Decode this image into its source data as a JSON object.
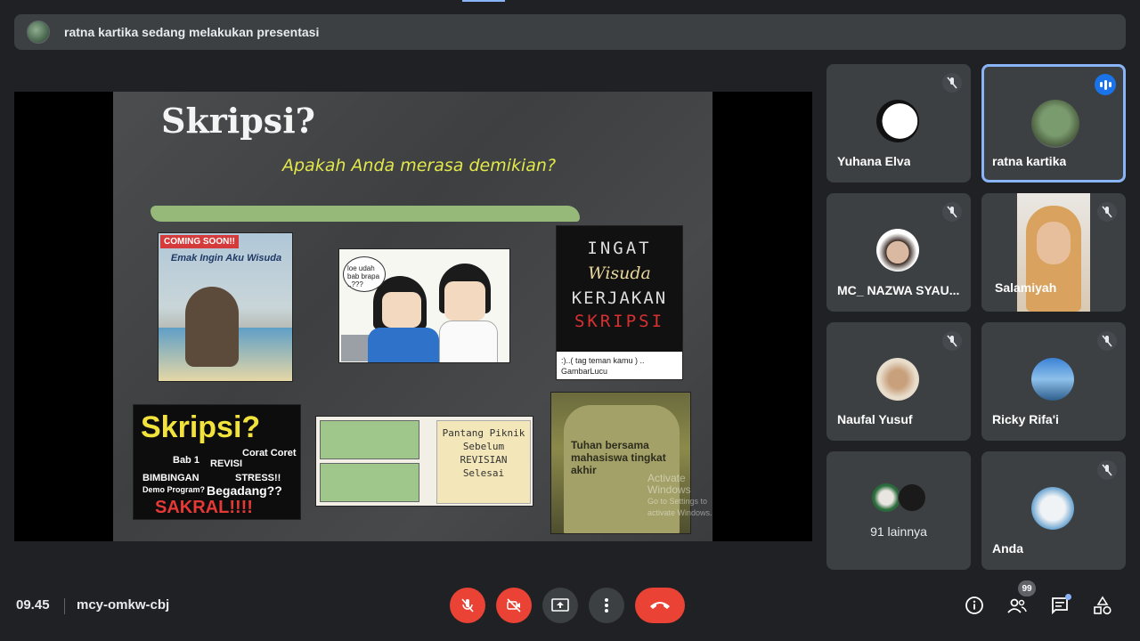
{
  "banner": {
    "text": "ratna kartika sedang melakukan presentasi"
  },
  "slide": {
    "title": "Skripsi?",
    "subtitle": "Apakah Anda merasa demikian?",
    "pic1": {
      "tag": "COMING SOON!!",
      "title": "Emak Ingin Aku Wisuda"
    },
    "pic2": {
      "bubble": "loe udah bab brapa ..???"
    },
    "pic3": {
      "line1": "INGAT",
      "line2": "Wisuda",
      "line3": "KERJAKAN",
      "line4": "SKRIPSI",
      "caption": ":)..( tag teman kamu ) .. GambarLucu"
    },
    "pic4": {
      "title": "Skripsi?",
      "w1": "Bab 1",
      "w2": "REVISI",
      "w3": "Corat Coret",
      "w4": "BIMBINGAN",
      "w5": "Demo Program?",
      "w6": "STRESS!!",
      "w7": "Begadang??",
      "w8": "SAKRAL!!!!"
    },
    "pic5": {
      "note": "Pantang Piknik Sebelum REVISIAN Selesai"
    },
    "pic6": {
      "text": "Tuhan bersama mahasiswa tingkat akhir"
    },
    "watermark": {
      "line1": "Activate Windows",
      "line2": "Go to Settings to activate Windows."
    }
  },
  "participants": [
    {
      "name": "Yuhana Elva",
      "muted": true
    },
    {
      "name": "ratna kartika",
      "muted": false,
      "speaking": true
    },
    {
      "name": "MC_ NAZWA SYAU...",
      "muted": true
    },
    {
      "name": "Salamiyah",
      "muted": true
    },
    {
      "name": "Naufal Yusuf",
      "muted": true
    },
    {
      "name": "Ricky Rifa'i",
      "muted": true
    },
    {
      "name": "91 lainnya"
    },
    {
      "name": "Anda",
      "muted": true
    }
  ],
  "bottom": {
    "time": "09.45",
    "meeting_code": "mcy-omkw-cbj",
    "people_count": "99"
  },
  "colors": {
    "accent": "#8ab4f8",
    "danger": "#ea4335",
    "tile": "#3c4043",
    "background": "#202124"
  }
}
